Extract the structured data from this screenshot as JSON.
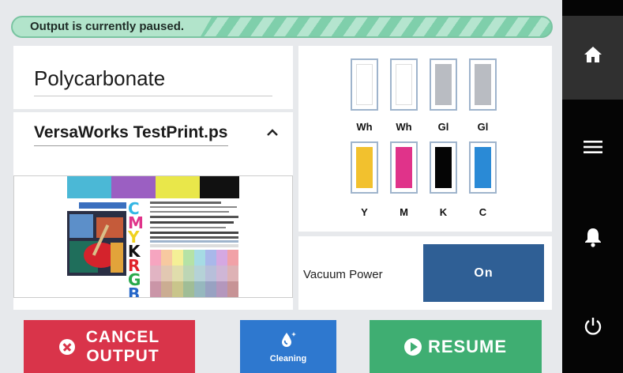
{
  "status": {
    "message": "Output is currently paused."
  },
  "media": {
    "name": "Polycarbonate"
  },
  "job": {
    "filename": "VersaWorks TestPrint.ps"
  },
  "ink": {
    "top_row": [
      {
        "label": "Wh",
        "color": "#ffffff"
      },
      {
        "label": "Wh",
        "color": "#ffffff"
      },
      {
        "label": "Gl",
        "color": "#b9bcc2"
      },
      {
        "label": "Gl",
        "color": "#b9bcc2"
      }
    ],
    "bottom_row": [
      {
        "label": "Y",
        "color": "#f2c12e"
      },
      {
        "label": "M",
        "color": "#e0338a"
      },
      {
        "label": "K",
        "color": "#050505"
      },
      {
        "label": "C",
        "color": "#2a8ad6"
      }
    ]
  },
  "vacuum": {
    "label": "Vacuum Power",
    "state": "On"
  },
  "buttons": {
    "cancel_line1": "CANCEL",
    "cancel_line2": "OUTPUT",
    "cleaning": "Cleaning",
    "resume": "RESUME"
  },
  "nav": {
    "items": [
      "home-icon",
      "menu-icon",
      "bell-icon",
      "power-icon"
    ]
  },
  "colors": {
    "banner": "#7fcfab",
    "cancel": "#d9344a",
    "cleaning": "#2e78cf",
    "resume": "#3fae72",
    "vacuum": "#2f5f95"
  }
}
